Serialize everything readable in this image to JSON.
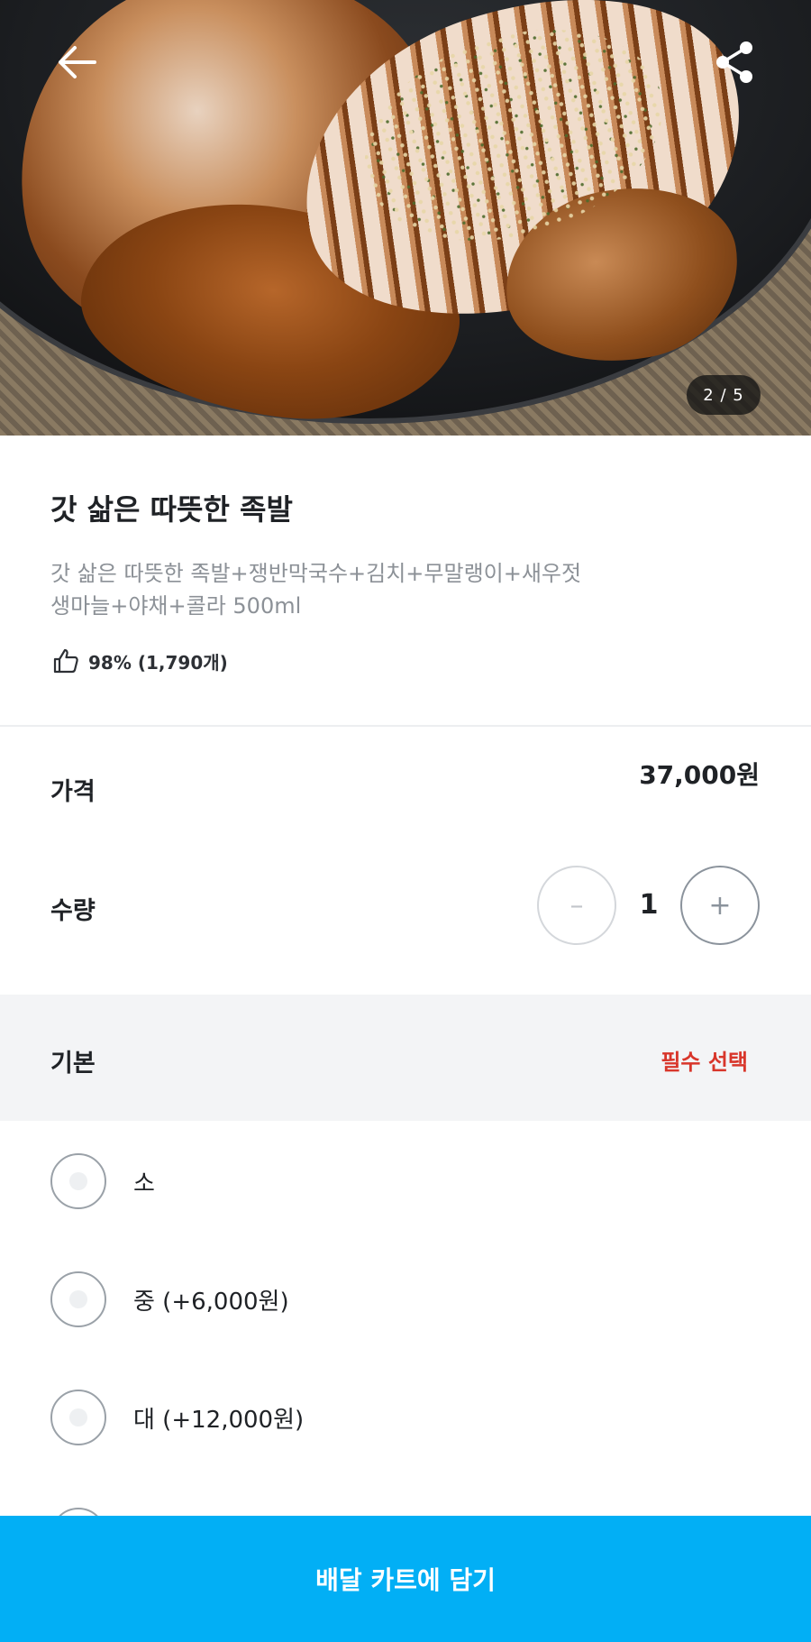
{
  "hero": {
    "pager": "2 / 5"
  },
  "product": {
    "title": "갓 삶은 따뜻한 족발",
    "description_line1": "갓 삶은 따뜻한 족발+쟁반막국수+김치+무말랭이+새우젓",
    "description_line2": "생마늘+야채+콜라 500ml",
    "rating": "98% (1,790개)"
  },
  "price": {
    "label": "가격",
    "value": "37,000원"
  },
  "quantity": {
    "label": "수량",
    "value": "1",
    "minus": "–",
    "plus": "+"
  },
  "options_section": {
    "title": "기본",
    "required": "필수 선택",
    "options": [
      {
        "label": "소"
      },
      {
        "label": "중 (+6,000원)"
      },
      {
        "label": "대 (+12,000원)"
      }
    ]
  },
  "cart_button": {
    "label": "배달 카트에 담기",
    "color": "#02aff5"
  },
  "icons": {
    "back": "back-arrow-icon",
    "share": "share-icon",
    "thumbs_up": "thumbs-up-icon"
  }
}
